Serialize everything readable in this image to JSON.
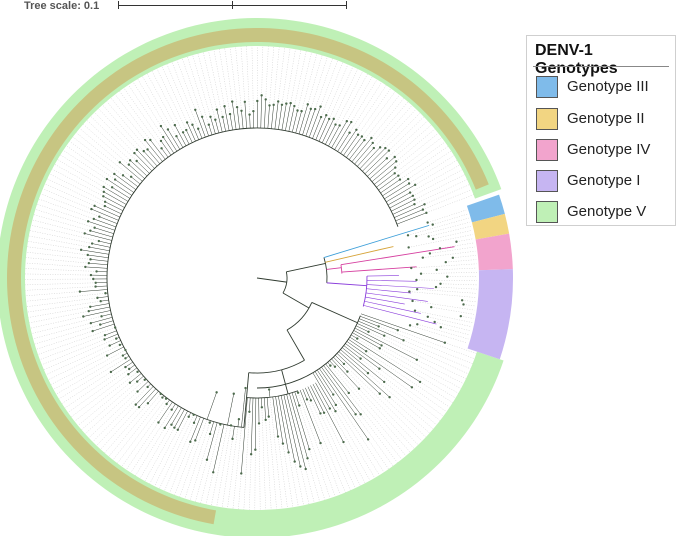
{
  "scale": {
    "label": "Tree scale: 0.1"
  },
  "legend": {
    "title": "DENV-1 Genotypes",
    "items": [
      {
        "label": "Genotype III",
        "color": "#7fbbea"
      },
      {
        "label": "Genotype II",
        "color": "#f2d582"
      },
      {
        "label": "Genotype IV",
        "color": "#f2a4cd"
      },
      {
        "label": "Genotype I",
        "color": "#c6b5f2"
      },
      {
        "label": "Genotype V",
        "color": "#bff0b6"
      }
    ]
  },
  "tree": {
    "layout": "circular",
    "branch_color_default": "#2f3a2f",
    "clade_branch_colors": {
      "Genotype III": "#3d9fd9",
      "Genotype II": "#d6a43a",
      "Genotype IV": "#d640a0",
      "Genotype I": "#8a3ddb",
      "Genotype V": "#2f3a2f"
    },
    "label_text_color": "#8a5a3a"
  }
}
